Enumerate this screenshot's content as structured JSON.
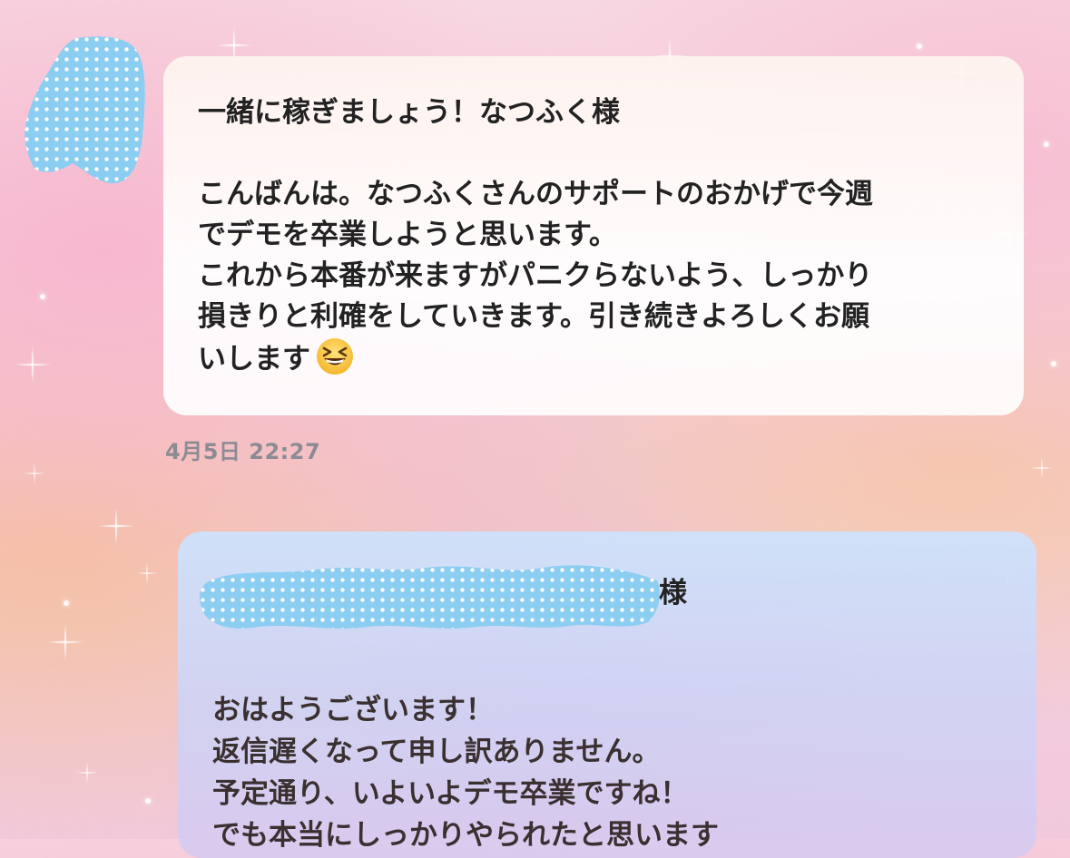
{
  "incoming_message": {
    "title": "一緒に稼ぎましょう！なつふく様",
    "lines": [
      "こんばんは。なつふくさんのサポートのおかげで今週",
      "でデモを卒業しようと思います。",
      "これから本番が来ますがパニクらないよう、しっかり",
      "損きりと利確をしていきます。引き続きよろしくお願",
      "いします"
    ],
    "emoji_icon": "grinning-squinting-face-icon",
    "timestamp": "4月5日 22:27"
  },
  "outgoing_message": {
    "salutation_suffix": "様",
    "lines": [
      "おはようございます！",
      "返信遅くなって申し訳ありません。",
      "予定通り、いよいよデモ卒業ですね！",
      "でも本当にしっかりやられたと思います"
    ]
  },
  "colors": {
    "redaction_fill": "#8ccdf2",
    "redaction_dots": "#ffffff",
    "timestamp": "#8b8b94"
  }
}
